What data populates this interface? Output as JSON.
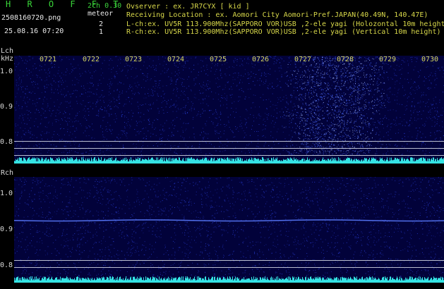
{
  "header": {
    "app_name": "H R O F F T",
    "filename": "2508160720.png",
    "datetime": "25.08.16 07:20",
    "channel_version": "2ch 0.30",
    "meteor_label": "meteor",
    "meteor_count_lch": "2",
    "meteor_count_rch": "1"
  },
  "info": {
    "observer_line": "Ovserver         : ex. JR7CYX [ kid ]",
    "location_line": "Receiving Location : ex. Aomori City Aomori-Pref.JAPAN(40.49N, 140.47E)",
    "lch_line": "L-ch:ex. UV5R 113.900Mhz(SAPPORO VOR)USB ,2-ele yagi (Holozontal 10m height)",
    "rch_line": "R-ch:ex. UV5R 113.900Mhz(SAPPORO VOR)USB ,2-ele yagi (Vertical 10m height)"
  },
  "time_axis": {
    "ticks": [
      "0721",
      "0722",
      "0723",
      "0724",
      "0725",
      "0726",
      "0727",
      "0728",
      "0729",
      "0730"
    ]
  },
  "lch_panel": {
    "channel_label": "Lch",
    "unit_label": "kHz",
    "y_ticks": [
      "1.0",
      "0.9",
      "0.8"
    ]
  },
  "rch_panel": {
    "channel_label": "Rch",
    "y_ticks": [
      "1.0",
      "0.9",
      "0.8"
    ]
  },
  "colors": {
    "background": "#000000",
    "panel": "#02023a",
    "noise": "#2a3fd8",
    "baseline": "#35e3e3",
    "header_green": "#3bd23b",
    "header_yellow": "#d8d84a"
  }
}
